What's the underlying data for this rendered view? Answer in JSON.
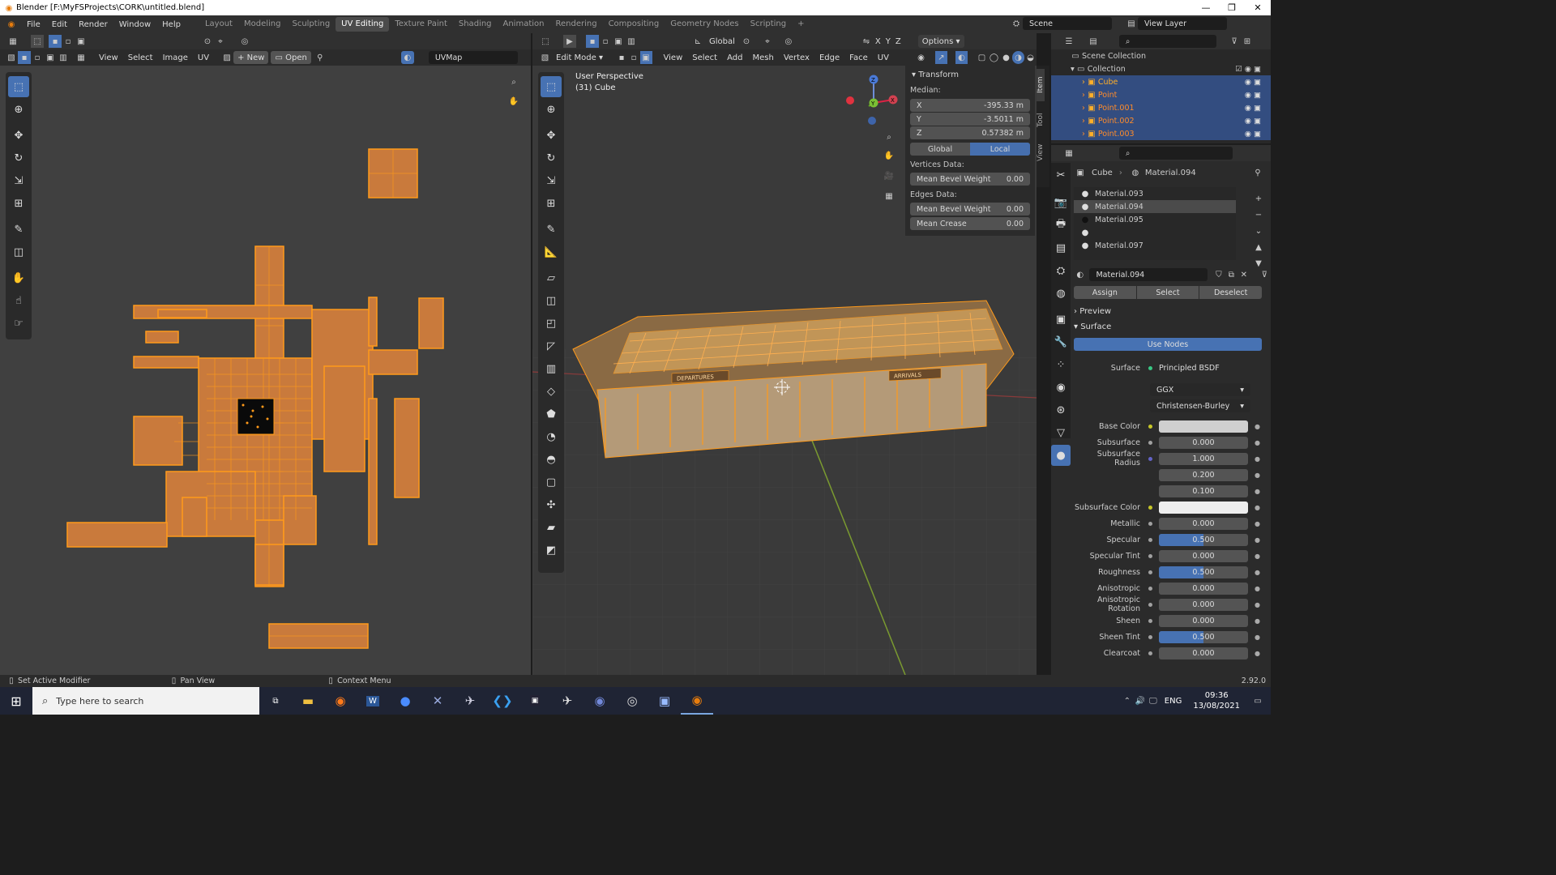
{
  "title": "Blender [F:\\MyFSProjects\\CORK\\untitled.blend]",
  "menus": [
    "File",
    "Edit",
    "Render",
    "Window",
    "Help"
  ],
  "workspaces": [
    "Layout",
    "Modeling",
    "Sculpting",
    "UV Editing",
    "Texture Paint",
    "Shading",
    "Animation",
    "Rendering",
    "Compositing",
    "Geometry Nodes",
    "Scripting"
  ],
  "active_workspace": "UV Editing",
  "scene_label": "Scene",
  "view_layer_label": "View Layer",
  "uv_editor": {
    "menus": [
      "View",
      "Select",
      "Image",
      "UV"
    ],
    "new_label": "New",
    "open_label": "Open",
    "uvmap": "UVMap"
  },
  "viewport": {
    "mode": "Edit Mode",
    "orientation": "Global",
    "options": "Options",
    "menus": [
      "View",
      "Select",
      "Add",
      "Mesh",
      "Vertex",
      "Edge",
      "Face",
      "UV"
    ],
    "overlay_title": "User Perspective",
    "overlay_obj": "(31) Cube",
    "sign_departures": "DEPARTURES",
    "sign_arrivals": "ARRIVALS",
    "axis_x": "X",
    "axis_y": "Y",
    "axis_z": "Z"
  },
  "transform": {
    "title": "Transform",
    "median": "Median:",
    "x_label": "X",
    "x_val": "-395.33 m",
    "y_label": "Y",
    "y_val": "-3.5011 m",
    "z_label": "Z",
    "z_val": "0.57382 m",
    "global": "Global",
    "local": "Local",
    "vertices_data": "Vertices Data:",
    "mean_bevel_weight": "Mean Bevel Weight",
    "vbw": "0.00",
    "edges_data": "Edges Data:",
    "ebw": "0.00",
    "mean_crease": "Mean Crease",
    "crease": "0.00"
  },
  "sidetabs": [
    "Item",
    "Tool",
    "View"
  ],
  "outliner": {
    "scene_collection": "Scene Collection",
    "collection": "Collection",
    "items": [
      "Cube",
      "Point",
      "Point.001",
      "Point.002",
      "Point.003"
    ]
  },
  "properties": {
    "object": "Cube",
    "material": "Material.094",
    "slots": [
      "Material.093",
      "Material.094",
      "Material.095",
      "",
      "Material.097"
    ],
    "mat_field": "Material.094",
    "assign": "Assign",
    "select": "Select",
    "deselect": "Deselect",
    "preview": "Preview",
    "surface_section": "Surface",
    "use_nodes": "Use Nodes",
    "surface_label": "Surface",
    "surface_val": "Principled BSDF",
    "dist": "GGX",
    "sss_method": "Christensen-Burley",
    "rows": [
      {
        "label": "Base Color",
        "value": "",
        "kind": "color",
        "color": "#cfcfcf"
      },
      {
        "label": "Subsurface",
        "value": "0.000"
      },
      {
        "label": "Subsurface Radius",
        "value": "1.000",
        "dot": "#6363c7"
      },
      {
        "label": "",
        "value": "0.200"
      },
      {
        "label": "",
        "value": "0.100"
      },
      {
        "label": "Subsurface Color",
        "value": "",
        "kind": "color",
        "color": "#eeeeee"
      },
      {
        "label": "Metallic",
        "value": "0.000"
      },
      {
        "label": "Specular",
        "value": "0.500",
        "blue": true
      },
      {
        "label": "Specular Tint",
        "value": "0.000"
      },
      {
        "label": "Roughness",
        "value": "0.500",
        "blue": true
      },
      {
        "label": "Anisotropic",
        "value": "0.000"
      },
      {
        "label": "Anisotropic Rotation",
        "value": "0.000"
      },
      {
        "label": "Sheen",
        "value": "0.000"
      },
      {
        "label": "Sheen Tint",
        "value": "0.500",
        "blue": true
      },
      {
        "label": "Clearcoat",
        "value": "0.000"
      }
    ]
  },
  "status": {
    "set_active": "Set Active Modifier",
    "pan": "Pan View",
    "context": "Context Menu",
    "version": "2.92.0"
  },
  "taskbar": {
    "search_placeholder": "Type here to search",
    "lang": "ENG",
    "time": "09:36",
    "date": "13/08/2021"
  },
  "colors": {
    "accent": "#4772b3",
    "uv_orange": "#d78a46",
    "edge_orange": "#ff9a1a",
    "bg": "#303030",
    "viewport": "#3c3c3c",
    "uvbg": "#404040"
  }
}
